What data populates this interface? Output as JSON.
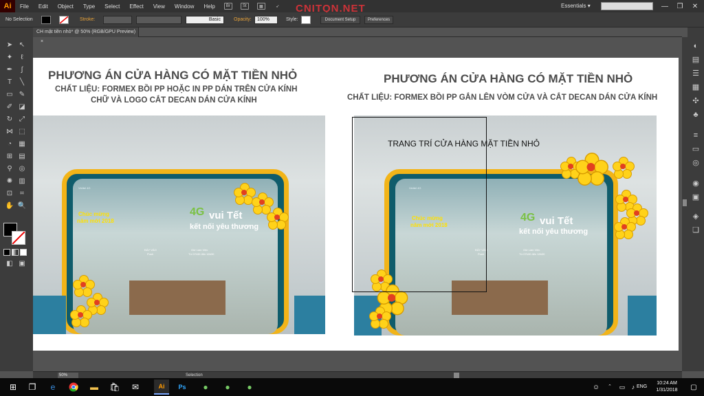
{
  "app": {
    "logo": "Ai",
    "watermark": "CNITQN.NET"
  },
  "menu": [
    "File",
    "Edit",
    "Object",
    "Type",
    "Select",
    "Effect",
    "View",
    "Window",
    "Help"
  ],
  "menubar_icons": [
    "bridge-icon",
    "stock-icon",
    "arrange-icon",
    "gpu-rocket-icon"
  ],
  "workspace": {
    "label": "Essentials",
    "search_placeholder": ""
  },
  "window_controls": [
    "—",
    "❐",
    "✕"
  ],
  "control_bar": {
    "selection": "No Selection",
    "stroke_label": "Stroke:",
    "opacity_label": "Opacity:",
    "opacity_value": "100%",
    "style_label": "Style:",
    "brush": "Basic",
    "document_setup": "Document Setup",
    "preferences": "Preferences"
  },
  "document": {
    "tab_title": "CH mặt tiền nhỏ* @ 50% (RGB/GPU Preview)",
    "close": "×"
  },
  "artboard": {
    "left_title": "PHƯƠNG ÁN CỬA HÀNG  CÓ MẶT TIỀN NHỎ",
    "left_sub1": "CHẤT LIỆU: FORMEX BỒI PP HOẶC IN PP DÁN TRÊN CỬA KÍNH",
    "left_sub2": "CHỮ VÀ LOGO CẮT DECAN DÁN CỬA KÍNH",
    "right_title": "PHƯƠNG ÁN CỬA HÀNG  CÓ MẶT TIỀN NHỎ",
    "right_sub1": "CHẤT LIỆU: FORMEX BỒI PP  GẮN LÊN VÒM CỬA VÀ CẮT DECAN DÁN CỬA KÍNH",
    "annotation": "TRANG TRÍ CỬA HÀNG MẶT TIỀN NHỎ",
    "shop": {
      "brand": "Viettel 4G",
      "logo_4g": "4G",
      "logo_text": "vui Tết",
      "slogan": "kết nối yêu thương",
      "greet1": "Chúc mừng",
      "greet2": "năm mới 2018",
      "push": "ĐẨY VÀO",
      "push_en": "Push",
      "hours_title": "Giờ Làm Việc",
      "hours": "Từ 07h30 đến 18h30"
    }
  },
  "status": {
    "zoom": "50%",
    "tool": "Selection"
  },
  "taskbar": {
    "apps": [
      "start-icon",
      "search-icon",
      "taskview-icon",
      "edge-icon",
      "chrome-icon",
      "explorer-icon",
      "store-icon",
      "mail-icon",
      "illustrator-icon",
      "photoshop-icon",
      "zalo-icon",
      "zalo2-icon",
      "zalo3-icon"
    ],
    "lang": "ENG",
    "time": "10:24 AM",
    "date": "1/31/2018"
  }
}
